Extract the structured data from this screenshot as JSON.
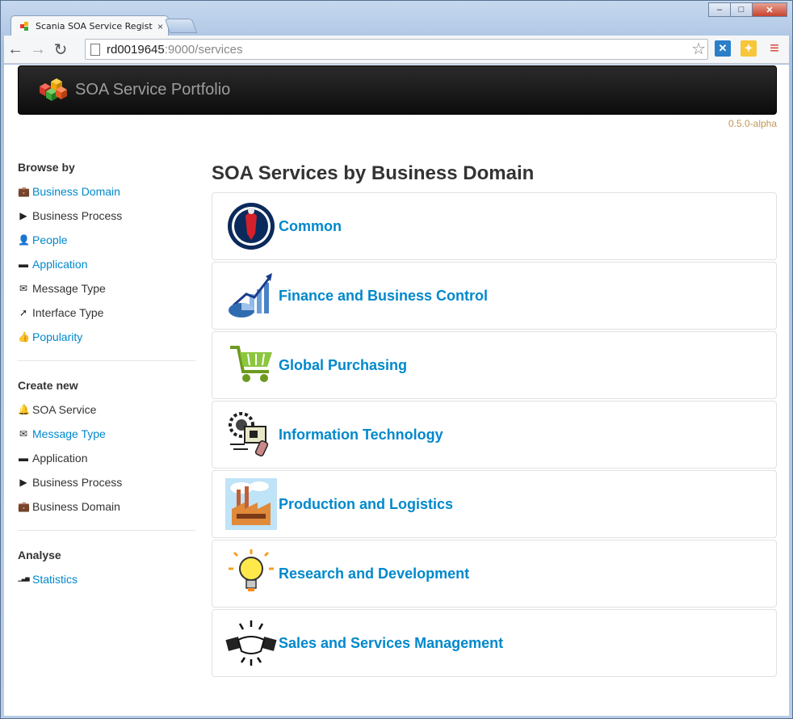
{
  "browser": {
    "tab_title": "Scania SOA Service Regist",
    "tab_close": "×",
    "url_host": "rd0019645",
    "url_rest": ":9000/services",
    "minimize": "–",
    "maximize": "□",
    "close": "✕"
  },
  "header": {
    "brand": "SOA Service Portfolio",
    "version": "0.5.0-alpha"
  },
  "sidebar": {
    "browse_heading": "Browse by",
    "browse": [
      {
        "label": "Business Domain",
        "icon": "briefcase-icon",
        "glyph": "💼",
        "link": true
      },
      {
        "label": "Business Process",
        "icon": "play-icon",
        "glyph": "▶",
        "link": false
      },
      {
        "label": "People",
        "icon": "user-icon",
        "glyph": "👤",
        "link": true
      },
      {
        "label": "Application",
        "icon": "hdd-icon",
        "glyph": "▬",
        "link": true
      },
      {
        "label": "Message Type",
        "icon": "envelope-icon",
        "glyph": "✉",
        "link": false
      },
      {
        "label": "Interface Type",
        "icon": "plug-icon",
        "glyph": "➚",
        "link": false
      },
      {
        "label": "Popularity",
        "icon": "thumbs-up-icon",
        "glyph": "👍",
        "link": true
      }
    ],
    "create_heading": "Create new",
    "create": [
      {
        "label": "SOA Service",
        "icon": "bell-icon",
        "glyph": "🔔",
        "link": false
      },
      {
        "label": "Message Type",
        "icon": "envelope-icon",
        "glyph": "✉",
        "link": true
      },
      {
        "label": "Application",
        "icon": "hdd-icon",
        "glyph": "▬",
        "link": false
      },
      {
        "label": "Business Process",
        "icon": "play-icon",
        "glyph": "▶",
        "link": false
      },
      {
        "label": "Business Domain",
        "icon": "briefcase-icon",
        "glyph": "💼",
        "link": false
      }
    ],
    "analyse_heading": "Analyse",
    "analyse": [
      {
        "label": "Statistics",
        "icon": "signal-icon",
        "glyph": "▁▃▅",
        "link": true
      }
    ]
  },
  "main": {
    "title": "SOA Services by Business Domain",
    "domains": [
      {
        "name": "Common",
        "icon": "scania-griffin-icon"
      },
      {
        "name": "Finance and Business Control",
        "icon": "finance-chart-icon"
      },
      {
        "name": "Global Purchasing",
        "icon": "shopping-cart-icon"
      },
      {
        "name": "Information Technology",
        "icon": "computer-gear-icon"
      },
      {
        "name": "Production and Logistics",
        "icon": "factory-icon"
      },
      {
        "name": "Research and Development",
        "icon": "lightbulb-icon"
      },
      {
        "name": "Sales and Services Management",
        "icon": "handshake-icon"
      }
    ]
  },
  "colors": {
    "link": "#0088cc",
    "navbar": "#111111",
    "version": "#c09853"
  }
}
